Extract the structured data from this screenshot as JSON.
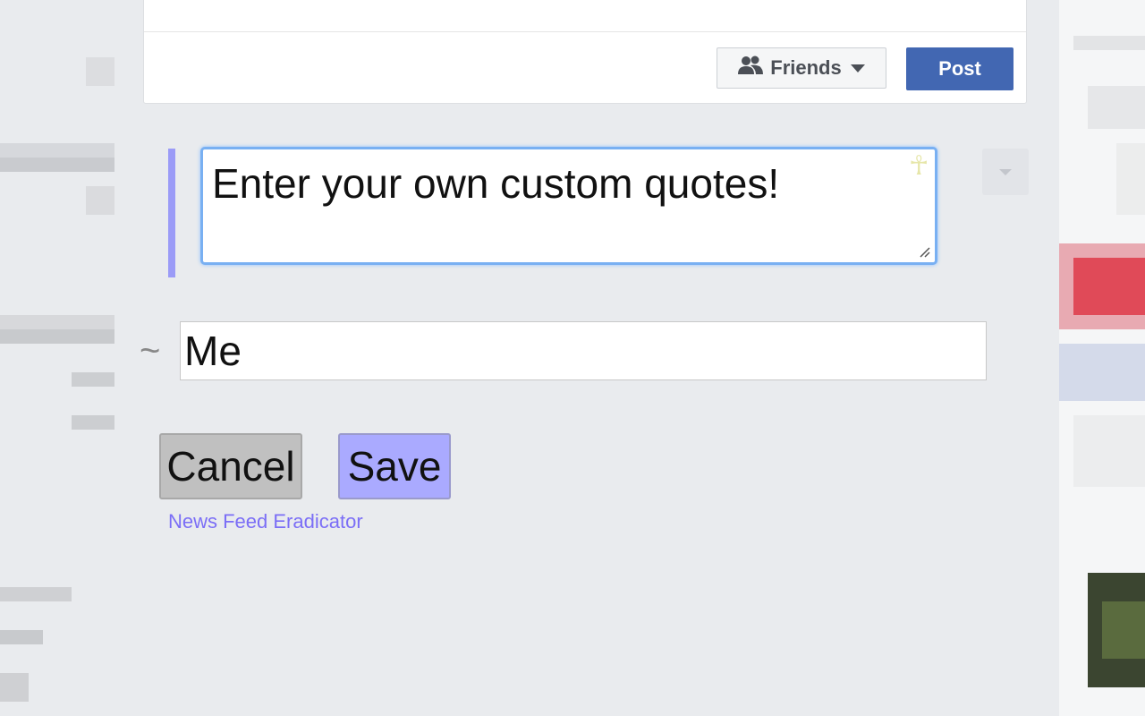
{
  "composer": {
    "audience_label": "Friends",
    "audience_icon": "friends-icon",
    "post_label": "Post"
  },
  "quote_editor": {
    "quote_text": "Enter your own custom quotes!",
    "ankh_glyph": "☥",
    "author_prefix": "~",
    "author_value": "Me",
    "cancel_label": "Cancel",
    "save_label": "Save",
    "extension_link": "News Feed Eradicator"
  },
  "colors": {
    "post_button": "#4267b2",
    "save_button": "#aaaaff",
    "cancel_button": "#c0c0c0",
    "quote_bar": "#9b9bf7",
    "link": "#7b6ef6",
    "focus_ring": "#79b0f2"
  }
}
